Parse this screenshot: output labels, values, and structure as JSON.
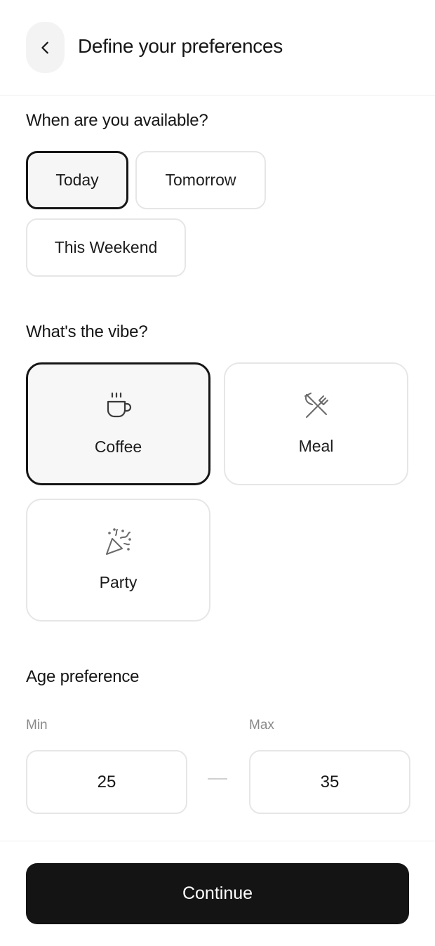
{
  "header": {
    "title": "Define your preferences",
    "back_icon": "chevron-left-icon"
  },
  "availability": {
    "title": "When are you available?",
    "options": [
      "Today",
      "Tomorrow",
      "This Weekend"
    ],
    "selected": "Today"
  },
  "vibe": {
    "title": "What's the vibe?",
    "options": [
      {
        "label": "Coffee",
        "icon": "coffee-cup-icon"
      },
      {
        "label": "Meal",
        "icon": "fork-knife-icon"
      },
      {
        "label": "Party",
        "icon": "party-popper-icon"
      }
    ],
    "selected": "Coffee"
  },
  "age": {
    "title": "Age preference",
    "min_label": "Min",
    "max_label": "Max",
    "min_value": "25",
    "max_value": "35"
  },
  "footer": {
    "continue_label": "Continue"
  },
  "colors": {
    "primary": "#141414",
    "border": "#e6e6e6",
    "selected_bg": "#f6f6f6",
    "muted_text": "#8a8a8a"
  }
}
